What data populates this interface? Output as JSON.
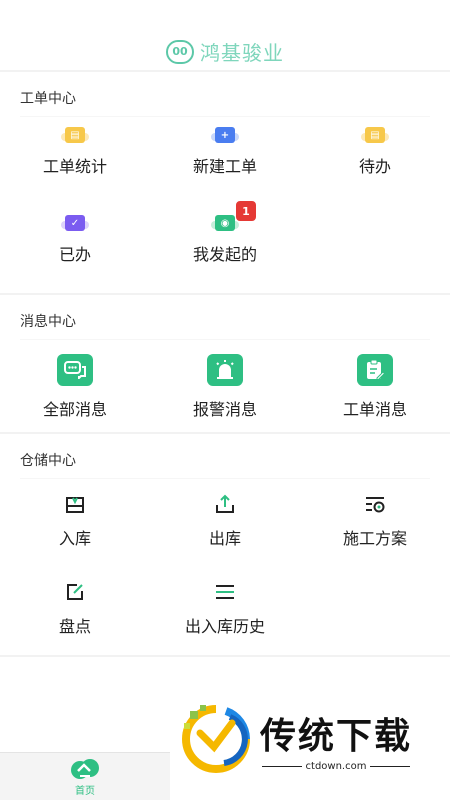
{
  "brand": {
    "logo_text": "00",
    "name": "鸿基骏业"
  },
  "sections": {
    "workorder": {
      "title": "工单中心",
      "items": [
        {
          "label": "工单统计"
        },
        {
          "label": "新建工单"
        },
        {
          "label": "待办"
        },
        {
          "label": "已办"
        },
        {
          "label": "我发起的",
          "badge": "1"
        }
      ]
    },
    "messages": {
      "title": "消息中心",
      "items": [
        {
          "label": "全部消息"
        },
        {
          "label": "报警消息"
        },
        {
          "label": "工单消息"
        }
      ]
    },
    "warehouse": {
      "title": "仓储中心",
      "items": [
        {
          "label": "入库"
        },
        {
          "label": "出库"
        },
        {
          "label": "施工方案"
        },
        {
          "label": "盘点"
        },
        {
          "label": "出入库历史"
        }
      ]
    }
  },
  "watermark": {
    "text": "传统下载",
    "url": "ctdown.com"
  },
  "tabbar": {
    "home_label": "首页"
  },
  "colors": {
    "accent": "#2ebf83",
    "brand": "#7fd6bc",
    "badge": "#e53935"
  }
}
